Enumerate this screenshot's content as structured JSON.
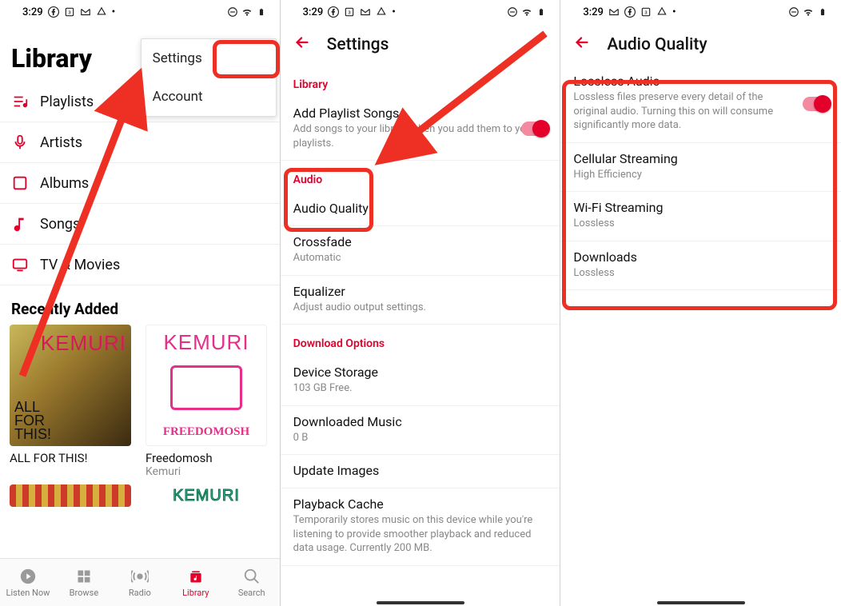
{
  "status": {
    "time": "3:29",
    "dot": "•"
  },
  "panel1": {
    "title": "Library",
    "items": [
      {
        "label": "Playlists"
      },
      {
        "label": "Artists"
      },
      {
        "label": "Albums"
      },
      {
        "label": "Songs"
      },
      {
        "label": "TV & Movies"
      }
    ],
    "recently_added": "Recently Added",
    "albums": [
      {
        "title": "ALL FOR THIS!",
        "artist": "",
        "band": "KEMURI"
      },
      {
        "title": "Freedomosh",
        "artist": "Kemuri",
        "band": "KEMURI",
        "bottom": "FREEDOMOSH"
      }
    ],
    "albums2": [
      {
        "band": ""
      },
      {
        "band": "KEMURI"
      }
    ],
    "menu": {
      "settings": "Settings",
      "account": "Account"
    },
    "tabs": [
      {
        "label": "Listen Now"
      },
      {
        "label": "Browse"
      },
      {
        "label": "Radio"
      },
      {
        "label": "Library"
      },
      {
        "label": "Search"
      }
    ]
  },
  "panel2": {
    "title": "Settings",
    "sections": {
      "library": "Library",
      "audio": "Audio",
      "download": "Download Options"
    },
    "rows": {
      "add_playlist": {
        "title": "Add Playlist Songs",
        "sub": "Add songs to your library when you add them to your playlists."
      },
      "audio_quality": {
        "title": "Audio Quality"
      },
      "crossfade": {
        "title": "Crossfade",
        "sub": "Automatic"
      },
      "equalizer": {
        "title": "Equalizer",
        "sub": "Adjust audio output settings."
      },
      "device_storage": {
        "title": "Device Storage",
        "sub": "103 GB Free."
      },
      "downloaded": {
        "title": "Downloaded Music",
        "sub": "0 B"
      },
      "update_images": {
        "title": "Update Images"
      },
      "playback_cache": {
        "title": "Playback Cache",
        "sub": "Temporarily stores music on this device while you're listening to provide smoother playback and reduced data usage. Currently 200 MB."
      }
    }
  },
  "panel3": {
    "title": "Audio Quality",
    "rows": {
      "lossless": {
        "title": "Lossless Audio",
        "sub": "Lossless files preserve every detail of the original audio. Turning this on will consume significantly more data."
      },
      "cellular": {
        "title": "Cellular Streaming",
        "sub": "High Efficiency"
      },
      "wifi": {
        "title": "Wi-Fi Streaming",
        "sub": "Lossless"
      },
      "downloads": {
        "title": "Downloads",
        "sub": "Lossless"
      }
    }
  }
}
